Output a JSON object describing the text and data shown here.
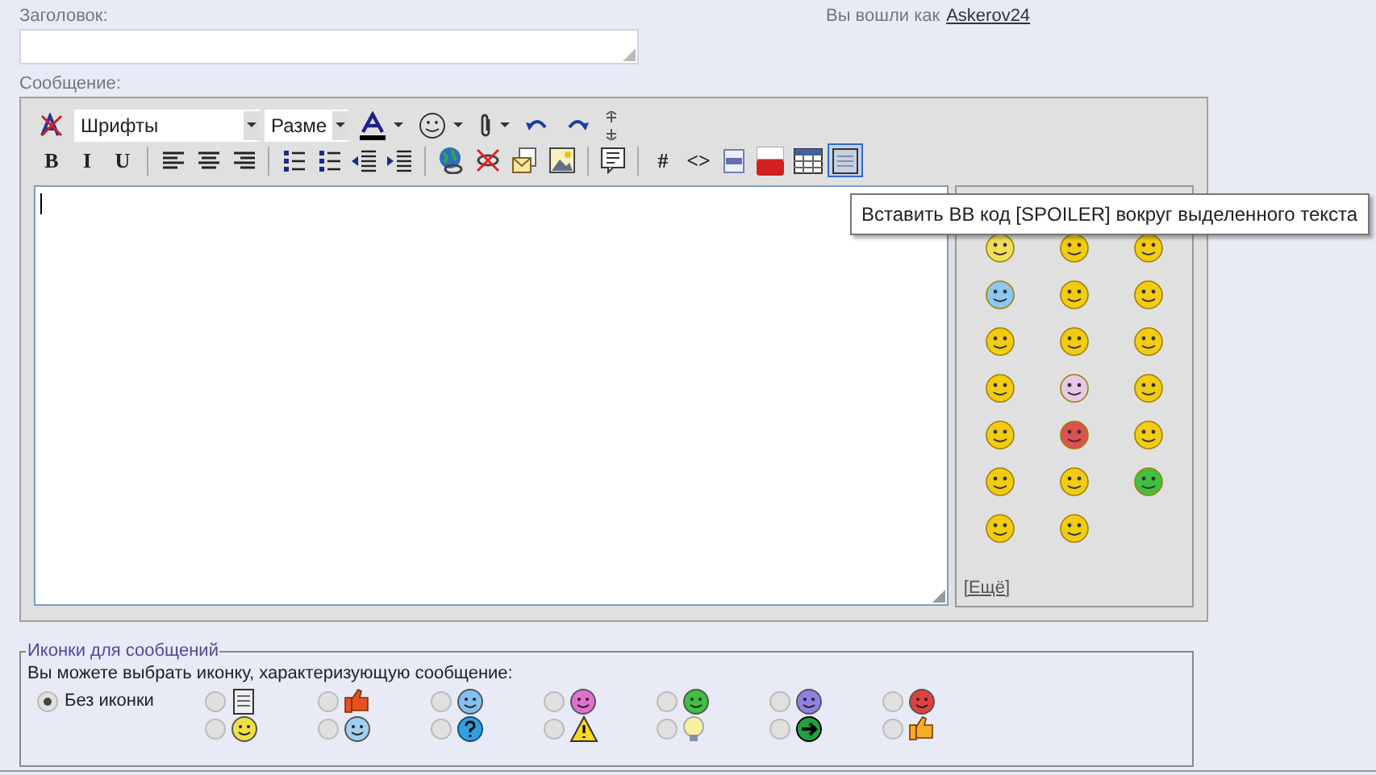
{
  "title_field": {
    "label": "Заголовок:"
  },
  "login": {
    "text": "Вы вошли как",
    "user": "Askerov24"
  },
  "message": {
    "label": "Сообщение:"
  },
  "toolbar_row_1": [
    {
      "kind": "remove-format"
    },
    {
      "kind": "select",
      "value": "Шрифты"
    },
    {
      "kind": "select-narrow",
      "value": "Разме"
    },
    {
      "kind": "font-color"
    },
    {
      "kind": "smiley-menu"
    },
    {
      "kind": "attach-menu"
    },
    {
      "kind": "undo"
    },
    {
      "kind": "redo"
    },
    {
      "kind": "resize"
    }
  ],
  "toolbar_row_2": [
    {
      "kind": "text",
      "label": "B",
      "hovered": false
    },
    {
      "kind": "text",
      "label": "I",
      "hovered": false
    },
    {
      "kind": "text",
      "label": "U",
      "hovered": false
    },
    {
      "kind": "sep"
    },
    {
      "kind": "align-left",
      "hovered": false
    },
    {
      "kind": "align-center",
      "hovered": false
    },
    {
      "kind": "align-right",
      "hovered": false
    },
    {
      "kind": "sep"
    },
    {
      "kind": "ordered-list",
      "hovered": false
    },
    {
      "kind": "bullet-list",
      "hovered": false
    },
    {
      "kind": "outdent",
      "hovered": false
    },
    {
      "kind": "indent",
      "hovered": false
    },
    {
      "kind": "sep"
    },
    {
      "kind": "link",
      "hovered": false
    },
    {
      "kind": "unlink",
      "hovered": false
    },
    {
      "kind": "email",
      "hovered": false
    },
    {
      "kind": "image",
      "hovered": false
    },
    {
      "kind": "sep"
    },
    {
      "kind": "quote",
      "hovered": false
    },
    {
      "kind": "sep"
    },
    {
      "kind": "text",
      "label": "#",
      "hovered": false
    },
    {
      "kind": "text",
      "label": "<>",
      "hovered": false
    },
    {
      "kind": "php",
      "hovered": false
    },
    {
      "kind": "video",
      "hovered": false
    },
    {
      "kind": "table",
      "hovered": false
    },
    {
      "kind": "spoiler",
      "hovered": true
    }
  ],
  "tooltip": "Вставить BB код [SPOILER] вокруг выделенного текста",
  "smileys": [
    {
      "color": "#f2de5a"
    },
    {
      "color": "#f2cc10"
    },
    {
      "color": "#f2cc10"
    },
    {
      "color": "#8cc8f0"
    },
    {
      "color": "#f2cc10"
    },
    {
      "color": "#f2cc10"
    },
    {
      "color": "#f2cc10"
    },
    {
      "color": "#f2cc10"
    },
    {
      "color": "#f2cc10"
    },
    {
      "color": "#f2cc10"
    },
    {
      "color": "#e8c8e8"
    },
    {
      "color": "#f2cc10"
    },
    {
      "color": "#f2cc10"
    },
    {
      "color": "#e05050"
    },
    {
      "color": "#f2cc10"
    },
    {
      "color": "#f2cc10"
    },
    {
      "color": "#f2cc10"
    },
    {
      "color": "#40c040"
    },
    {
      "color": "#f2cc10"
    },
    {
      "color": "#f2cc10"
    }
  ],
  "more_link": "[Ещё]",
  "post_icons": {
    "legend": "Иконки для сообщений",
    "hint": "Вы можете выбрать иконку, характеризующую сообщение:",
    "none_label": "Без иконки",
    "none_selected": true,
    "icons": [
      {
        "kind": "document",
        "color": "#f0f0f0",
        "selected": false
      },
      {
        "kind": "thumb",
        "color": "#e85020",
        "selected": false
      },
      {
        "kind": "face",
        "color": "#80c0f0",
        "selected": false
      },
      {
        "kind": "face",
        "color": "#e070d0",
        "selected": false
      },
      {
        "kind": "face",
        "color": "#40c040",
        "selected": false
      },
      {
        "kind": "face",
        "color": "#9080e0",
        "selected": false
      },
      {
        "kind": "face",
        "color": "#e04040",
        "selected": false
      },
      {
        "kind": "face",
        "color": "#f2e040",
        "selected": false
      },
      {
        "kind": "face",
        "color": "#a0d0f0",
        "selected": false
      },
      {
        "kind": "question",
        "color": "#30a0e0",
        "selected": false
      },
      {
        "kind": "warning",
        "color": "#f8d820",
        "selected": false
      },
      {
        "kind": "bulb",
        "color": "#f8f0a0",
        "selected": false
      },
      {
        "kind": "arrow",
        "color": "#20a040",
        "selected": false
      },
      {
        "kind": "thumb",
        "color": "#f0b020",
        "selected": false
      }
    ]
  }
}
